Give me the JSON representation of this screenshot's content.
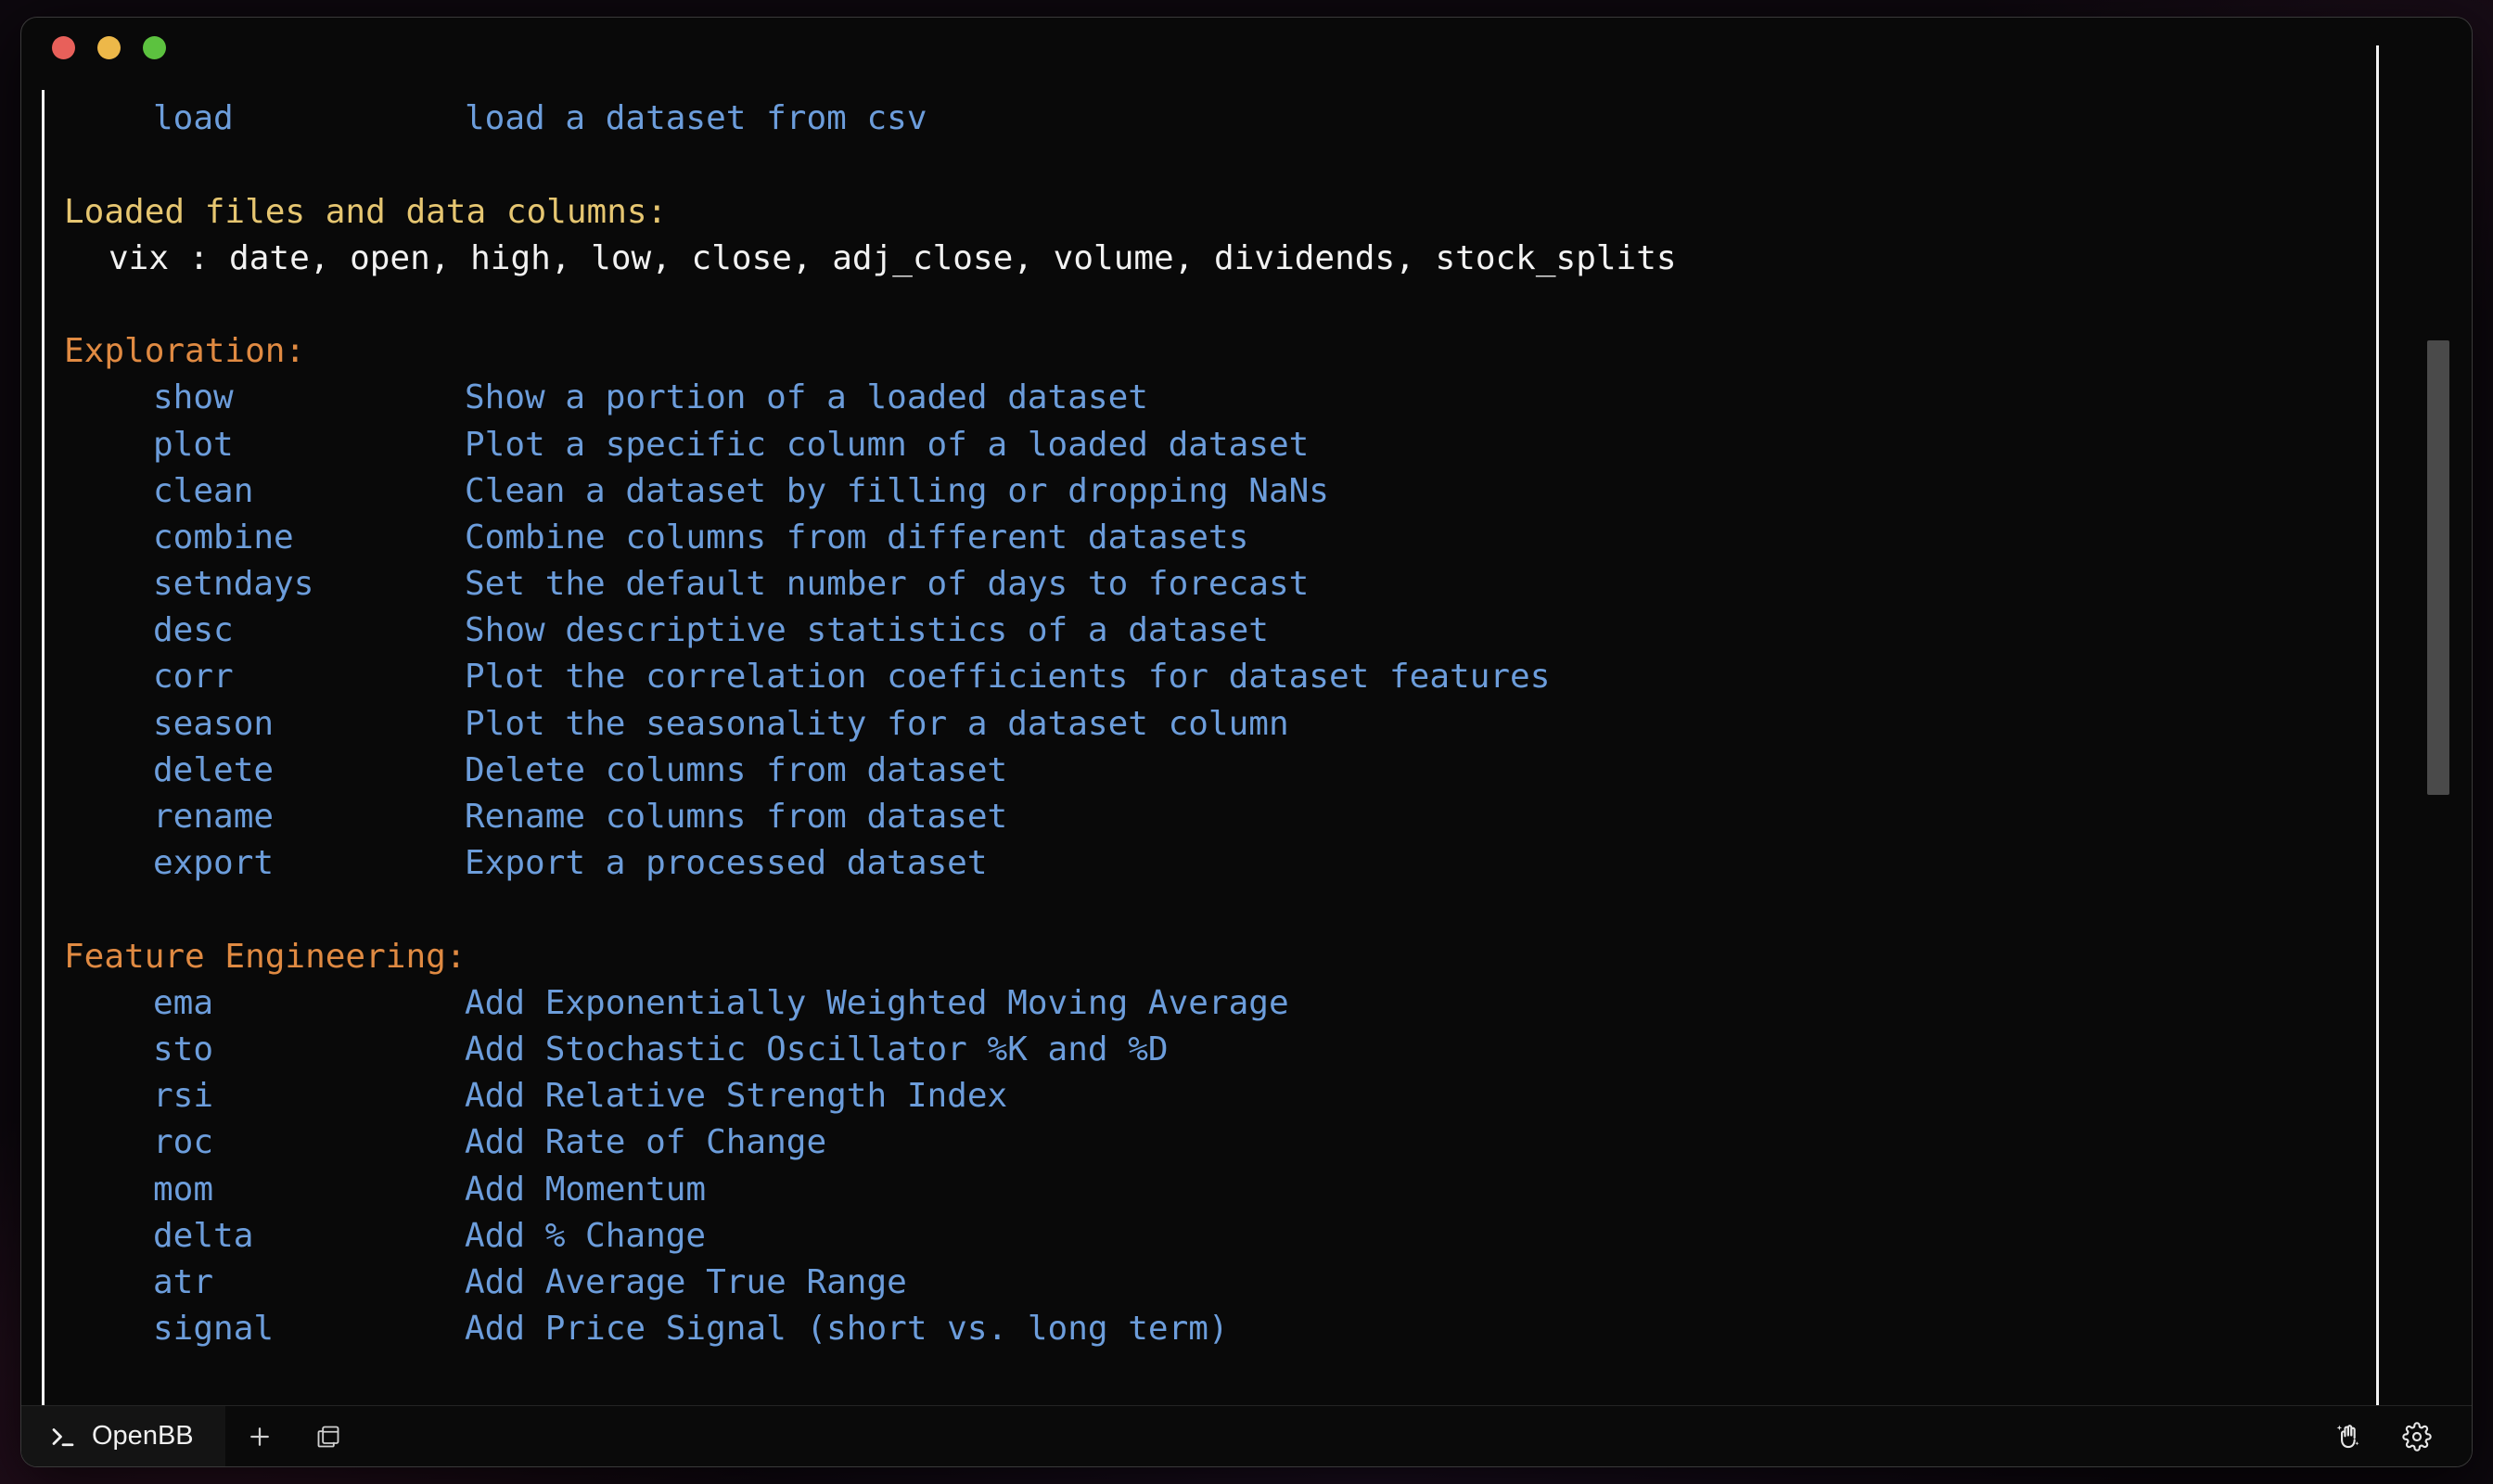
{
  "window": {
    "traffic_lights": [
      {
        "name": "close",
        "color": "#e8605a"
      },
      {
        "name": "minimize",
        "color": "#edb849"
      },
      {
        "name": "maximize",
        "color": "#5cc23f"
      }
    ]
  },
  "terminal": {
    "top_command": {
      "name": "load",
      "description": "load a dataset from csv"
    },
    "loaded": {
      "header": "Loaded files and data columns:",
      "entries": [
        {
          "text": "vix : date, open, high, low, close, adj_close, volume, dividends, stock_splits"
        }
      ]
    },
    "sections": [
      {
        "title": "Exploration:",
        "commands": [
          {
            "name": "show",
            "description": "Show a portion of a loaded dataset"
          },
          {
            "name": "plot",
            "description": "Plot a specific column of a loaded dataset"
          },
          {
            "name": "clean",
            "description": "Clean a dataset by filling or dropping NaNs"
          },
          {
            "name": "combine",
            "description": "Combine columns from different datasets"
          },
          {
            "name": "setndays",
            "description": "Set the default number of days to forecast"
          },
          {
            "name": "desc",
            "description": "Show descriptive statistics of a dataset"
          },
          {
            "name": "corr",
            "description": "Plot the correlation coefficients for dataset features"
          },
          {
            "name": "season",
            "description": "Plot the seasonality for a dataset column"
          },
          {
            "name": "delete",
            "description": "Delete columns from dataset"
          },
          {
            "name": "rename",
            "description": "Rename columns from dataset"
          },
          {
            "name": "export",
            "description": "Export a processed dataset"
          }
        ]
      },
      {
        "title": "Feature Engineering:",
        "commands": [
          {
            "name": "ema",
            "description": "Add Exponentially Weighted Moving Average"
          },
          {
            "name": "sto",
            "description": "Add Stochastic Oscillator %K and %D"
          },
          {
            "name": "rsi",
            "description": "Add Relative Strength Index"
          },
          {
            "name": "roc",
            "description": "Add Rate of Change"
          },
          {
            "name": "mom",
            "description": "Add Momentum"
          },
          {
            "name": "delta",
            "description": "Add % Change"
          },
          {
            "name": "atr",
            "description": "Add Average True Range"
          },
          {
            "name": "signal",
            "description": "Add Price Signal (short vs. long term)"
          }
        ]
      }
    ],
    "colors": {
      "command": "#6c9ddb",
      "description": "#6c9ddb",
      "loaded_header": "#e6c671",
      "loaded_entry": "#f2f2f2",
      "section_title": "#e08a42",
      "background": "#090909"
    }
  },
  "statusbar": {
    "tab": {
      "label": "OpenBB",
      "icon": "prompt-icon"
    },
    "new_tab_label": "+",
    "split_pane_icon": "split-pane-icon",
    "magic_icon": "magic-hand-icon",
    "settings_icon": "gear-icon"
  }
}
